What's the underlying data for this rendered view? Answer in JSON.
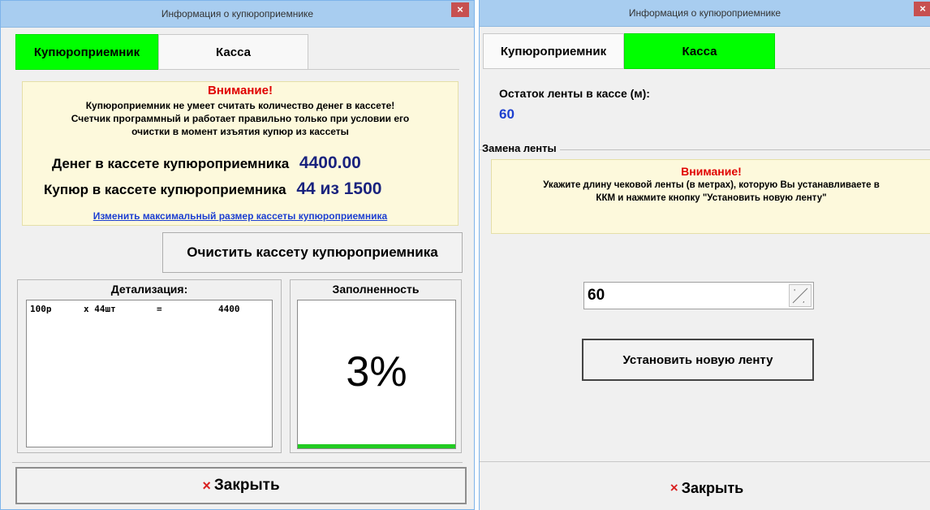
{
  "left_window": {
    "title": "Информация о купюроприемнике",
    "close_glyph": "×",
    "tabs": [
      {
        "label": "Купюроприемник",
        "active": true
      },
      {
        "label": "Касса",
        "active": false
      }
    ],
    "warning": {
      "title": "Внимание!",
      "line1": "Купюроприемник не умеет считать количество денег в кассете!",
      "line2": "Счетчик программный и работает правильно только при условии его",
      "line3": "очистки в момент изъятия купюр из кассеты"
    },
    "money_label": "Денег в кассете купюроприемника",
    "money_value": "4400.00",
    "bills_label": "Купюр в кассете купюроприемника",
    "bills_value": "44 из 1500",
    "change_link": "Изменить максимальный размер кассеты купюроприемника",
    "clear_button": "Очистить кассету купюроприемника",
    "details": {
      "title": "Детализация:",
      "rows": [
        {
          "denom": "100р",
          "count": "x 44шт",
          "eq": "=",
          "sum": "4400"
        }
      ]
    },
    "fill": {
      "title": "Заполненность",
      "percent_text": "3%",
      "fraction": 0.03
    },
    "close_button": {
      "icon": "×",
      "label": "Закрыть"
    }
  },
  "right_window": {
    "title": "Информация о купюроприемнике",
    "close_glyph": "×",
    "tabs": [
      {
        "label": "Купюроприемник",
        "active": false
      },
      {
        "label": "Касса",
        "active": true
      }
    ],
    "tape_label": "Остаток ленты в кассе (м):",
    "tape_value": "60",
    "replace_group": "Замена ленты",
    "warning": {
      "title": "Внимание!",
      "line1": "Укажите длину чековой ленты (в метрах), которую Вы устанавливаете в",
      "line2": "ККМ и нажмите кнопку \"Установить новую ленту\""
    },
    "new_tape_input": "60",
    "set_button": "Установить новую ленту",
    "close_button": {
      "icon": "×",
      "label": "Закрыть"
    }
  },
  "colors": {
    "accent_green": "#00ff00",
    "value_blue": "#1a237e",
    "warn_red": "#e00000"
  }
}
